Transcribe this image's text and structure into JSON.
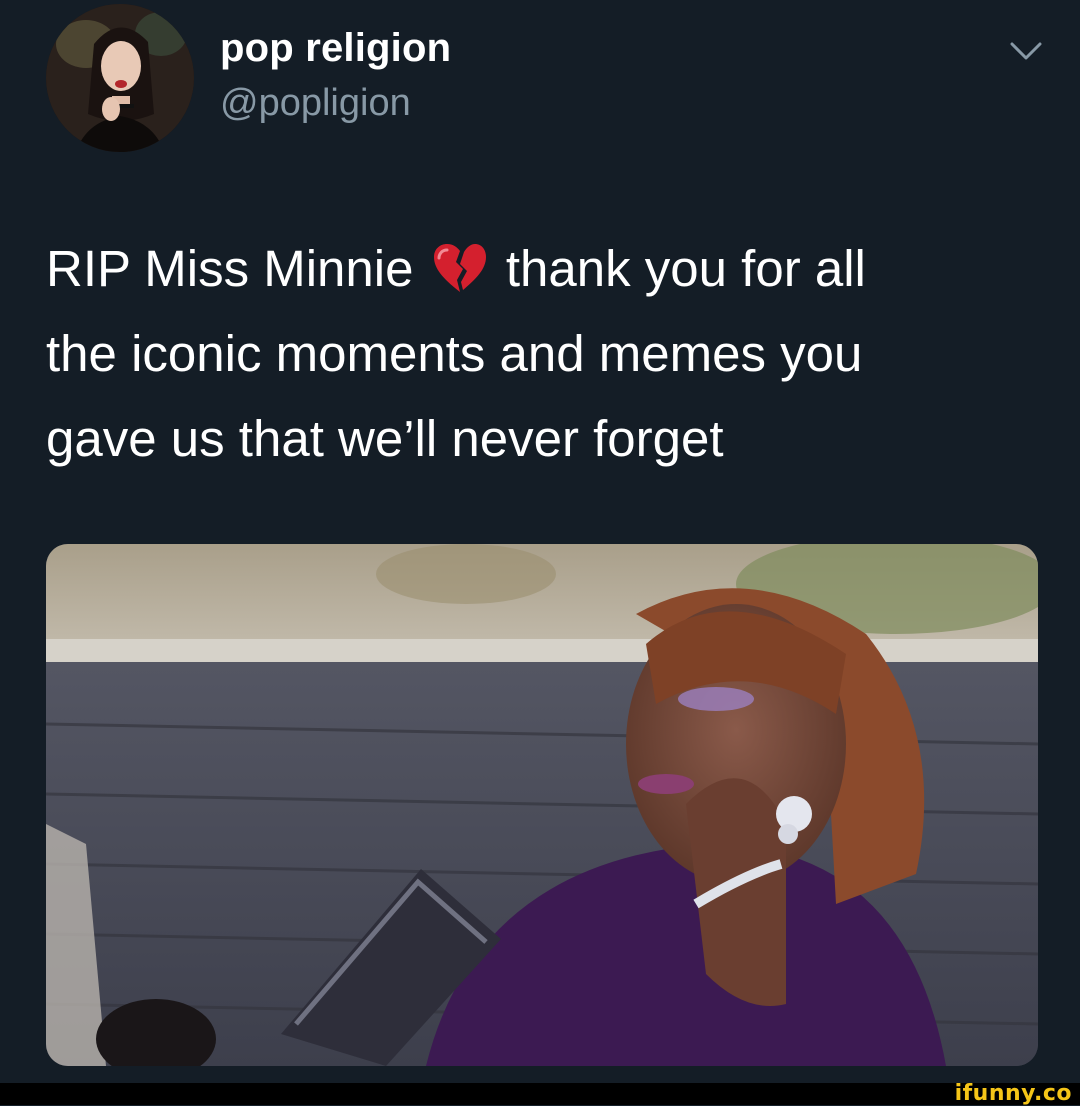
{
  "tweet": {
    "display_name": "pop religion",
    "handle": "@popligion",
    "text_lines": {
      "line1_before": "RIP Miss Minnie",
      "line1_after": "thank you for all",
      "line2": "the iconic moments and memes you",
      "line3": "gave us that we’ll never forget"
    },
    "emoji": "broken-heart-icon",
    "menu_icon": "chevron-down-icon"
  },
  "media": {
    "type": "photo"
  },
  "watermark": {
    "text": "ifunny.co"
  },
  "colors": {
    "background": "#141d26",
    "text": "#ffffff",
    "secondary_text": "#8899a6",
    "watermark": "#f5c518"
  }
}
